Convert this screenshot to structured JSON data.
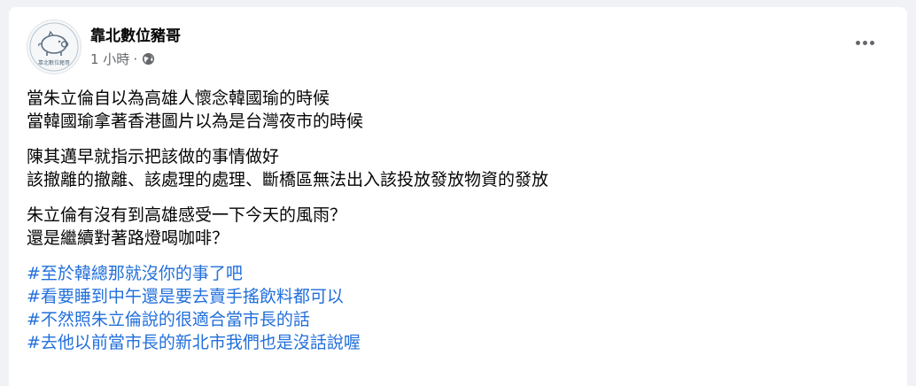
{
  "post": {
    "author": "靠北數位豬哥",
    "time": "1 小時",
    "meta_separator": "·",
    "privacy_icon": "globe-icon",
    "more_icon": "more-options-icon",
    "avatar_icon": "pig-logo-icon",
    "avatar_text": "靠北數位豬哥",
    "paragraphs": [
      {
        "lines": [
          "當朱立倫自以為高雄人懷念韓國瑜的時候",
          "當韓國瑜拿著香港圖片以為是台灣夜市的時候"
        ]
      },
      {
        "lines": [
          "陳其邁早就指示把該做的事情做好",
          "該撤離的撤離、該處理的處理、斷橋區無法出入該投放發放物資的發放"
        ]
      },
      {
        "lines": [
          "朱立倫有沒有到高雄感受一下今天的風雨？",
          "還是繼續對著路燈喝咖啡？"
        ]
      }
    ],
    "hashtags": [
      "#至於韓總那就沒你的事了吧",
      "#看要睡到中午還是要去賣手搖飲料都可以",
      "#不然照朱立倫說的很適合當市長的話",
      "#去他以前當市長的新北市我們也是沒話說喔"
    ]
  },
  "colors": {
    "text": "#050505",
    "secondary": "#65676b",
    "link": "#216fdb",
    "background": "#f0f2f5",
    "card": "#ffffff"
  }
}
